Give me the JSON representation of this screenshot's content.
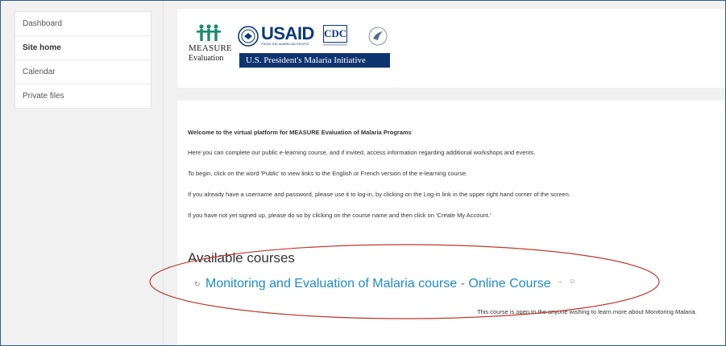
{
  "sidebar": {
    "items": [
      {
        "label": "Dashboard"
      },
      {
        "label": "Site home"
      },
      {
        "label": "Calendar"
      },
      {
        "label": "Private files"
      }
    ]
  },
  "header": {
    "measure_name": "MEASURE",
    "measure_sub": "Evaluation",
    "usaid": "USAID",
    "usaid_tag": "FROM THE AMERICAN PEOPLE",
    "cdc": "CDC",
    "pmi": "U.S. President's Malaria Initiative"
  },
  "main": {
    "welcome": "Welcome to the virtual platform for MEASURE Evaluation of Malaria Programs",
    "paragraphs": [
      "Here you can complete our public e-learning course, and if invited, access information regarding additional workshops and events.",
      "To begin, click on the word 'Public' to view links to the English or French version of the e-learning course.",
      "If you already have a username and password, please use it to log-in, by clicking on the Log-in link in the upper right hand corner of the screen.",
      "If you have not yet signed up, please do so by clicking on the course name and then click on 'Create My Account.'"
    ],
    "courses_heading": "Available courses",
    "course": {
      "name": "Monitoring and Evaluation of Malaria course - Online Course",
      "summary": "This course is open to the anyone wishing to learn more about Monitoring Malaria."
    }
  },
  "colors": {
    "link": "#1f8cc8",
    "frame_border": "#2b5d96",
    "highlight": "#c0392b",
    "pmi_bar": "#0e3470"
  },
  "icons": {
    "course": "course-icon",
    "enrol": "enrol-icon",
    "guest": "guest-icon"
  }
}
